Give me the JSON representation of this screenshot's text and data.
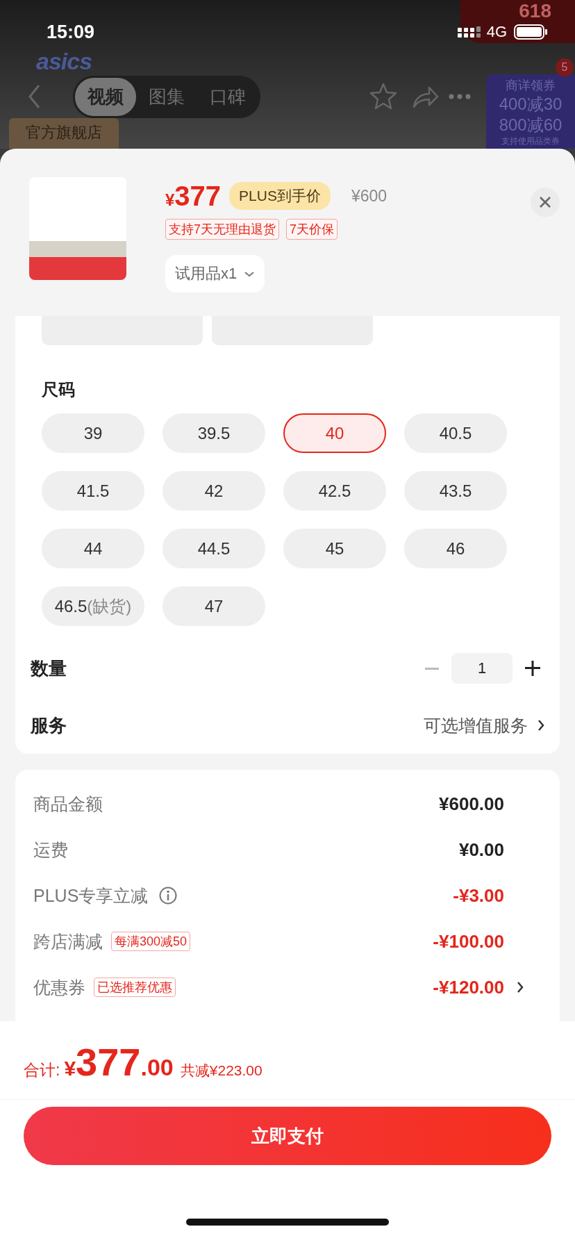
{
  "status_bar": {
    "time": "15:09",
    "network": "4G"
  },
  "backdrop": {
    "logo": "asics",
    "tabs": [
      {
        "label": "视频",
        "selected": true
      },
      {
        "label": "图集",
        "selected": false
      },
      {
        "label": "口碑",
        "selected": false
      }
    ],
    "store_badge": "官方旗舰店",
    "corner_badge": "618",
    "promo": {
      "title": "商详领券",
      "count": "5",
      "lines": [
        "400减30",
        "800减60"
      ],
      "footnote": "支持使用品类券"
    }
  },
  "product": {
    "currency": "¥",
    "price": "377",
    "price_label": "PLUS到手价",
    "original_price": "¥600",
    "tags": [
      "支持7天无理由退货",
      "7天价保"
    ],
    "variant": "试用品x1"
  },
  "size_section": {
    "title": "尺码",
    "sizes": [
      {
        "label": "39",
        "selected": false
      },
      {
        "label": "39.5",
        "selected": false
      },
      {
        "label": "40",
        "selected": true
      },
      {
        "label": "40.5",
        "selected": false
      },
      {
        "label": "41.5",
        "selected": false
      },
      {
        "label": "42",
        "selected": false
      },
      {
        "label": "42.5",
        "selected": false
      },
      {
        "label": "43.5",
        "selected": false
      },
      {
        "label": "44",
        "selected": false
      },
      {
        "label": "44.5",
        "selected": false
      },
      {
        "label": "45",
        "selected": false
      },
      {
        "label": "46",
        "selected": false
      },
      {
        "label": "46.5",
        "note": "(缺货)",
        "selected": false
      },
      {
        "label": "47",
        "selected": false
      }
    ],
    "quantity": {
      "label": "数量",
      "value": "1"
    },
    "service": {
      "label": "服务",
      "value": "可选增值服务"
    }
  },
  "summary": [
    {
      "label": "商品金额",
      "info": false,
      "kind": "charge",
      "value": "¥600.00",
      "chevron": false
    },
    {
      "label": "运费",
      "info": false,
      "kind": "charge",
      "value": "¥0.00",
      "chevron": false
    },
    {
      "label": "PLUS专享立减",
      "info": true,
      "kind": "discount",
      "value": "-¥3.00",
      "chevron": false
    },
    {
      "label": "跨店满减",
      "tag": "每满300减50",
      "info": false,
      "kind": "discount",
      "value": "-¥100.00",
      "chevron": false
    },
    {
      "label": "优惠券",
      "tag": "已选推荐优惠",
      "info": false,
      "kind": "discount",
      "value": "-¥120.00",
      "chevron": true
    }
  ],
  "total": {
    "label": "合计:",
    "currency": "¥",
    "integer": "377",
    "decimal": ".00",
    "saving": "共减¥223.00"
  },
  "pay_button": "立即支付"
}
